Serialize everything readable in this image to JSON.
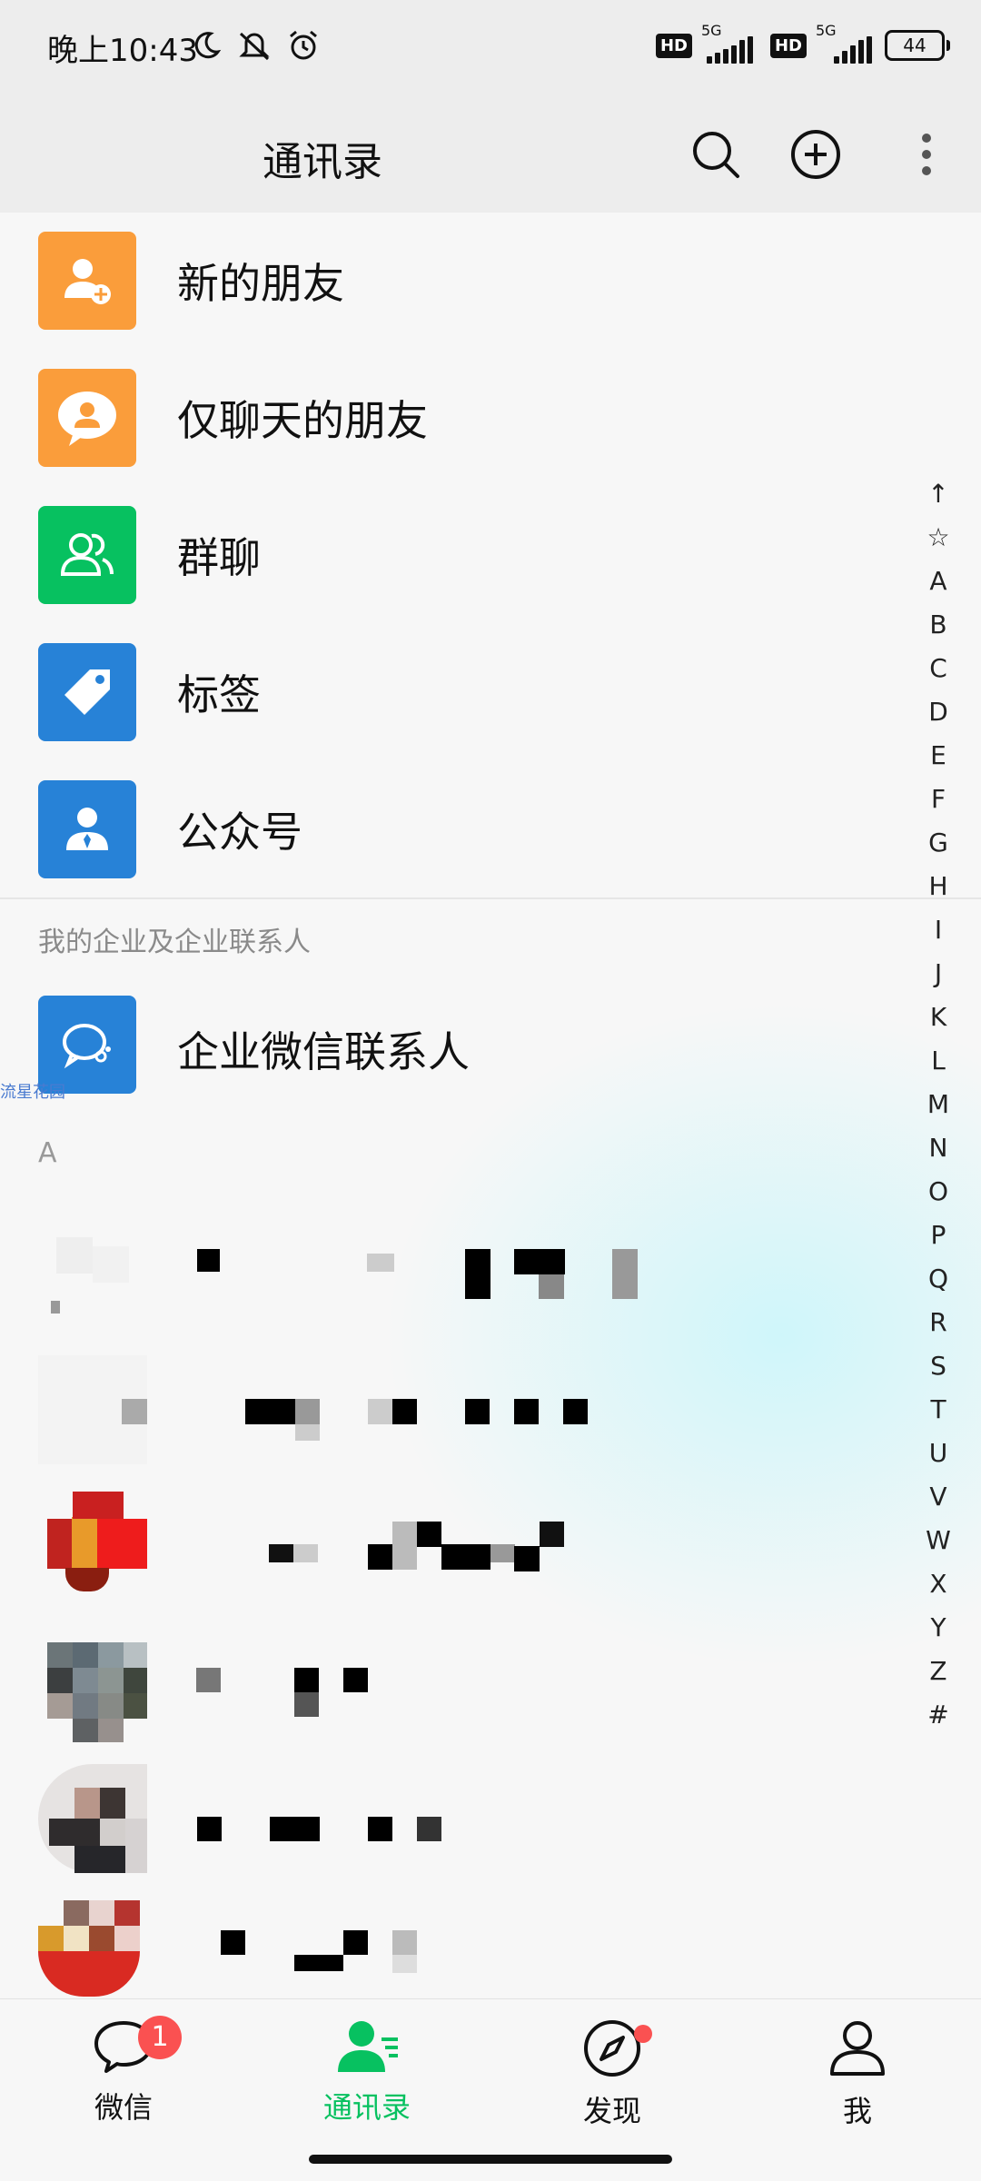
{
  "status_bar": {
    "time": "晚上10:43",
    "icons": [
      "moon-icon",
      "mute-icon",
      "alarm-icon"
    ],
    "network_labels": [
      "HD",
      "5G",
      "HD",
      "5G"
    ],
    "battery": "44"
  },
  "header": {
    "title": "通讯录"
  },
  "functions": [
    {
      "label": "新的朋友",
      "icon": "add-friend-icon",
      "color": "#fa9d3b"
    },
    {
      "label": "仅聊天的朋友",
      "icon": "chat-only-icon",
      "color": "#fa9d3b"
    },
    {
      "label": "群聊",
      "icon": "group-icon",
      "color": "#07c160"
    },
    {
      "label": "标签",
      "icon": "tag-icon",
      "color": "#2782d7"
    },
    {
      "label": "公众号",
      "icon": "official-account-icon",
      "color": "#2782d7"
    }
  ],
  "enterprise": {
    "section_label": "我的企业及企业联系人",
    "item_label": "企业微信联系人",
    "icon": "wecom-icon",
    "color": "#2782d7"
  },
  "floating_text": "流星花园",
  "contacts_section": {
    "letter": "A"
  },
  "index_letters": [
    "↑",
    "☆",
    "A",
    "B",
    "C",
    "D",
    "E",
    "F",
    "G",
    "H",
    "I",
    "J",
    "K",
    "L",
    "M",
    "N",
    "O",
    "P",
    "Q",
    "R",
    "S",
    "T",
    "U",
    "V",
    "W",
    "X",
    "Y",
    "Z",
    "#"
  ],
  "tabbar": {
    "tabs": [
      {
        "label": "微信",
        "icon": "chat-bubble-icon",
        "active": false,
        "badge": "1"
      },
      {
        "label": "通讯录",
        "icon": "contacts-icon",
        "active": true
      },
      {
        "label": "发现",
        "icon": "compass-icon",
        "active": false,
        "dot": true
      },
      {
        "label": "我",
        "icon": "person-icon",
        "active": false
      }
    ]
  },
  "colors": {
    "accent": "#07c160",
    "badge": "#fa5151",
    "orange": "#fa9d3b",
    "blue": "#2782d7"
  }
}
